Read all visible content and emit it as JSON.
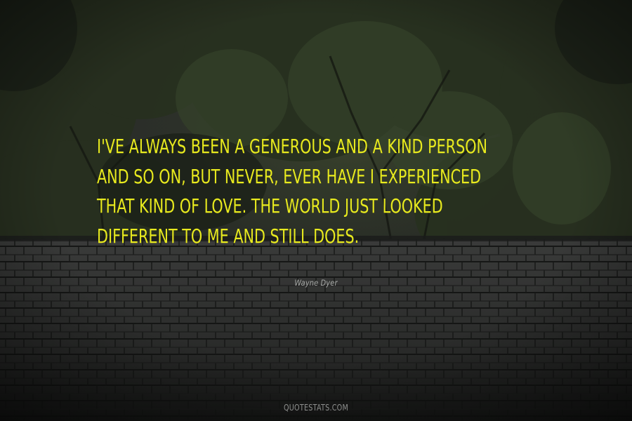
{
  "quote": {
    "lines": [
      "I've always been a generous and a kind person",
      "and so on, but never, ever have I experienced",
      "that kind of love. The world just looked",
      "different to me and still does."
    ],
    "color": "#e8ea1e"
  },
  "author": "Wayne Dyer",
  "watermark": "QUOTESTATS.COM",
  "background": {
    "description_colors": {
      "sky": "#2a2c2b",
      "foliage": "#2e3a22",
      "roof": "#3a3a3a"
    }
  }
}
